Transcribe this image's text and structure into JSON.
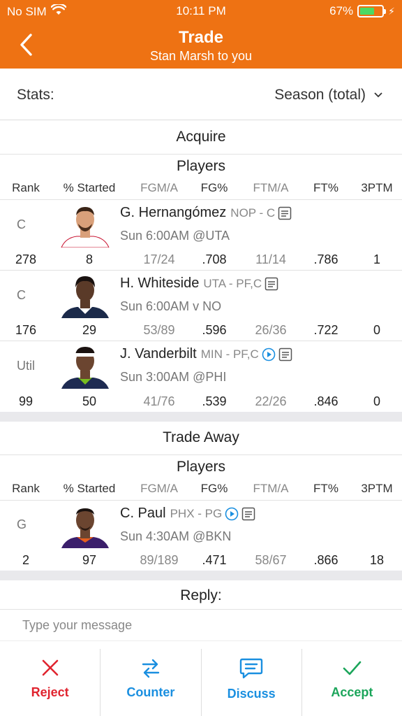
{
  "status": {
    "carrier": "No SIM",
    "time": "10:11 PM",
    "battery": "67%",
    "battery_level": 0.67
  },
  "nav": {
    "title": "Trade",
    "subtitle": "Stan Marsh to you"
  },
  "stats": {
    "label": "Stats:",
    "selected": "Season (total)"
  },
  "acquire": {
    "title": "Acquire",
    "subtitle": "Players",
    "headers": [
      "Rank",
      "% Started",
      "FGM/A",
      "FG%",
      "FTM/A",
      "FT%",
      "3PTM"
    ],
    "players": [
      {
        "slot": "C",
        "name": "G. Hernangómez",
        "team": "NOP - C",
        "game": "Sun 6:00AM @UTA",
        "stats": [
          "278",
          "8",
          "17/24",
          ".708",
          "11/14",
          ".786",
          "1"
        ],
        "video": false,
        "jersey": "#ffffff",
        "skin": "#d9a07a"
      },
      {
        "slot": "C",
        "name": "H. Whiteside",
        "team": "UTA - PF,C",
        "game": "Sun 6:00AM v NO",
        "stats": [
          "176",
          "29",
          "53/89",
          ".596",
          "26/36",
          ".722",
          "0"
        ],
        "video": false,
        "jersey": "#1b2a4a",
        "skin": "#5a3a28"
      },
      {
        "slot": "Util",
        "name": "J. Vanderbilt",
        "team": "MIN - PF,C",
        "game": "Sun 3:00AM @PHI",
        "stats": [
          "99",
          "50",
          "41/76",
          ".539",
          "22/26",
          ".846",
          "0"
        ],
        "video": true,
        "jersey": "#1e2b52",
        "skin": "#6b4530"
      }
    ]
  },
  "trade_away": {
    "title": "Trade Away",
    "subtitle": "Players",
    "headers": [
      "Rank",
      "% Started",
      "FGM/A",
      "FG%",
      "FTM/A",
      "FT%",
      "3PTM"
    ],
    "players": [
      {
        "slot": "G",
        "name": "C. Paul",
        "team": "PHX - PG",
        "game": "Sun 4:30AM @BKN",
        "stats": [
          "2",
          "97",
          "89/189",
          ".471",
          "58/67",
          ".866",
          "18"
        ],
        "video": true,
        "jersey": "#3b1f6b",
        "skin": "#6b4530"
      }
    ]
  },
  "reply": {
    "title": "Reply:",
    "placeholder": "Type your message"
  },
  "actions": [
    {
      "label": "Reject",
      "icon": "close-icon",
      "color": "#e0242f"
    },
    {
      "label": "Counter",
      "icon": "swap-icon",
      "color": "#1a8fe0"
    },
    {
      "label": "Discuss",
      "icon": "chat-icon",
      "color": "#1a8fe0"
    },
    {
      "label": "Accept",
      "icon": "check-icon",
      "color": "#1ba55a"
    }
  ],
  "colors": {
    "header": "#EE7213",
    "muted": "#888888",
    "band": "#e9e9ec"
  }
}
